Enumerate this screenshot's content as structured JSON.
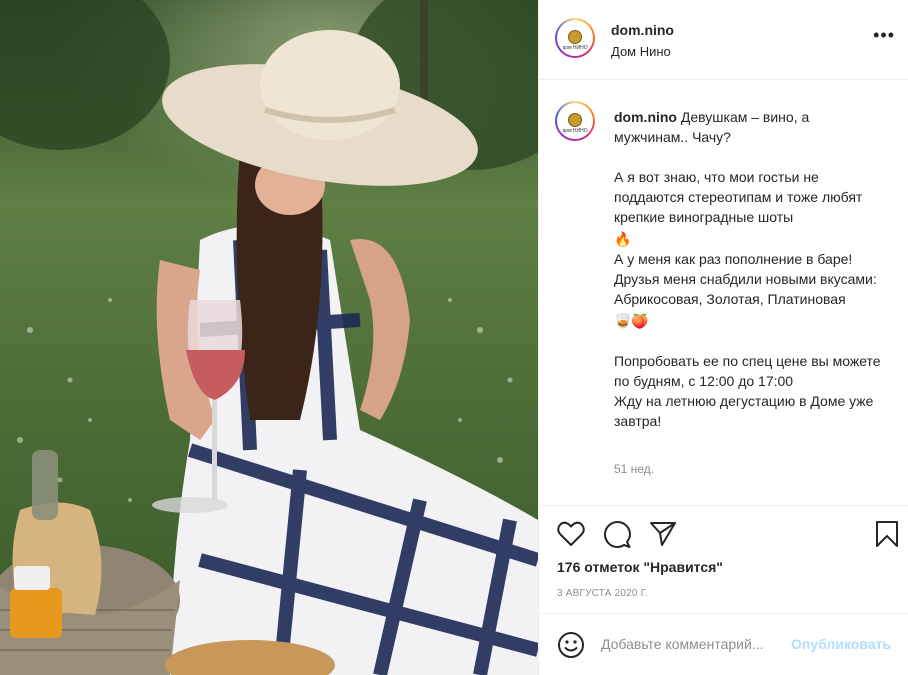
{
  "account": {
    "username": "dom.nino",
    "location": "Дом Нино",
    "avatar_text": "дом НИНО"
  },
  "header": {
    "more_icon": "more-horizontal-icon",
    "more_label": "•••"
  },
  "caption": {
    "username": "dom.nino",
    "text": " Девушкам – вино, а мужчинам.. Чачу?\n\nА я вот знаю, что мои гостьи не поддаются стереотипам и тоже любят крепкие виноградные шоты\n",
    "emoji_1": "🔥",
    "text_2": "\nА у меня как раз пополнение в баре! Друзья меня снабдили новыми вкусами:\nАбрикосовая, Золотая, Платиновая\n",
    "emoji_2": "🥃🍑",
    "text_3": "\n\nПопробовать ее по спец цене вы можете по будням, с 12:00 до 17:00\nЖду на летнюю дегустацию в Доме уже завтра!",
    "time_ago": "51 нед."
  },
  "actions": {
    "icons": [
      "heart-icon",
      "comment-icon",
      "share-icon",
      "bookmark-icon"
    ],
    "likes": "176 отметок \"Нравится\"",
    "date": "3 АВГУСТА 2020 Г."
  },
  "comment": {
    "placeholder": "Добавьте комментарий...",
    "post_label": "Опубликовать"
  },
  "colors": {
    "text": "#262626",
    "secondary": "#8e8e8e",
    "post_button_disabled": "#b2dffc",
    "divider": "#efefef"
  }
}
